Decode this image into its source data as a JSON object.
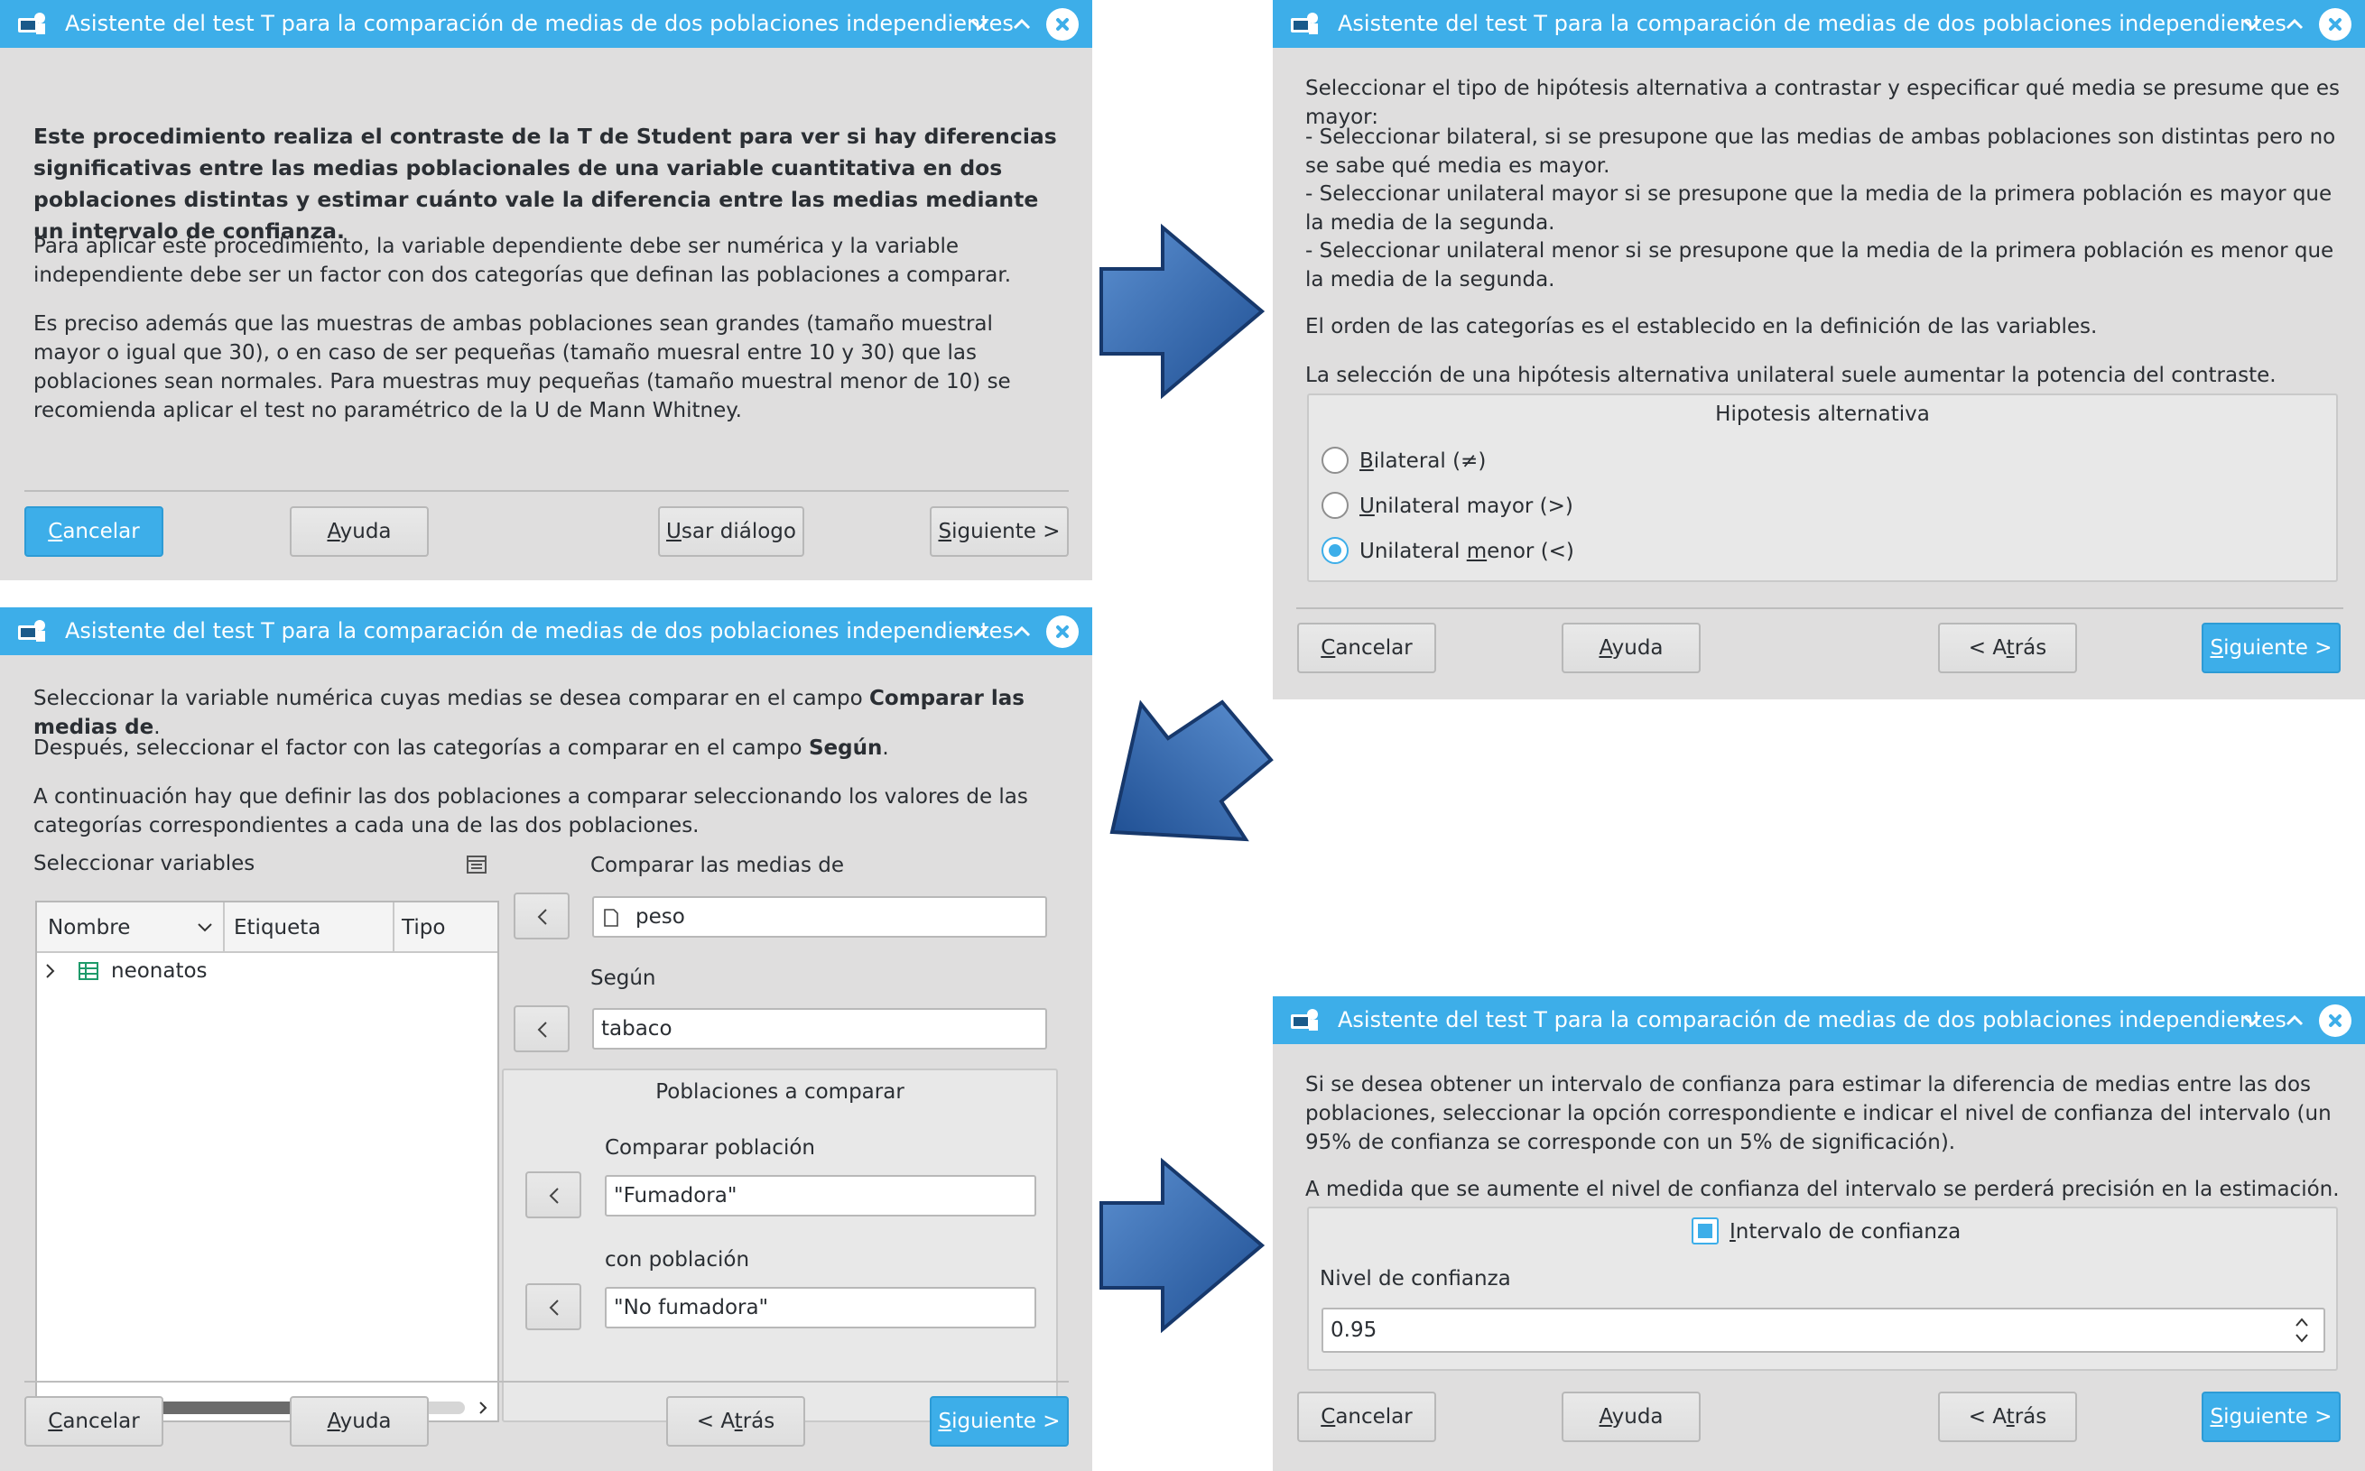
{
  "window_title": "Asistente del test T para la comparación de medias de dos poblaciones independientes",
  "buttons": {
    "cancel_pre": "",
    "cancel_ul": "C",
    "cancel_post": "ancelar",
    "help_pre": "",
    "help_ul": "A",
    "help_post": "yuda",
    "use_dialog_pre": "",
    "use_dialog_ul": "U",
    "use_dialog_post": "sar diálogo",
    "next_pre": "",
    "next_ul": "S",
    "next_post": "iguiente >",
    "back_pre": "< A",
    "back_ul": "t",
    "back_post": "rás"
  },
  "step1": {
    "intro_bold": "Este procedimiento realiza el contraste de la T de Student para ver si hay diferencias significativas entre las medias poblacionales de una variable cuantitativa en dos poblaciones distintas y estimar cuánto vale la diferencia entre las medias mediante un intervalo de confianza.",
    "para2": "Para aplicar este procedimiento, la variable dependiente debe ser numérica y la variable independiente debe ser un factor con dos categorías que definan las poblaciones a comparar.",
    "para3": "Es preciso además que las muestras de ambas poblaciones sean grandes (tamaño muestral mayor o igual que 30), o en caso de ser pequeñas (tamaño muesral entre 10 y 30) que las poblaciones sean normales. Para muestras muy pequeñas (tamaño muestral menor de 10) se recomienda aplicar el test no paramétrico de la U de Mann Whitney."
  },
  "step2": {
    "line1": "Seleccionar el tipo de hipótesis alternativa a contrastar y especificar qué media se presume que es mayor:",
    "bullet1": "- Seleccionar bilateral, si se presupone que las medias de ambas poblaciones son distintas pero no se sabe qué media es mayor.",
    "bullet2": "- Seleccionar unilateral mayor si se presupone que la media de la primera población es mayor que la media de la segunda.",
    "bullet3": "- Seleccionar unilateral menor si se presupone que la media de la primera población es menor que la media de la segunda.",
    "order": "El orden de las categorías es el establecido en la definición de las variables.",
    "power": "La selección de una hipótesis alternativa unilateral suele aumentar la potencia del contraste.",
    "group_title": "Hipotesis alternativa",
    "opt1_ul": "B",
    "opt1_post": "ilateral (≠)",
    "opt2_ul": "U",
    "opt2_post": "nilateral mayor (>)",
    "opt3_pre": "Unilateral ",
    "opt3_ul": "m",
    "opt3_post": "enor (<)",
    "selected": "Unilateral menor (<)"
  },
  "step3": {
    "line1_pre": "Seleccionar la variable numérica cuyas medias se desea comparar en el campo ",
    "line1_bold": "Comparar las medias de",
    "line1_post": ".",
    "line2_pre": "Después, seleccionar el factor con las categorías a comparar en el campo ",
    "line2_bold": "Según",
    "line2_post": ".",
    "line3": "A continuación hay que definir las dos poblaciones a comparar seleccionando los valores de las categorías correspondientes a cada una de las dos poblaciones.",
    "select_vars": "Seleccionar variables",
    "col_name": "Nombre",
    "col_label": "Etiqueta",
    "col_type": "Tipo",
    "tree_item": "neonatos",
    "compare_label": "Comparar las medias de",
    "compare_value": "peso",
    "segun_label": "Según",
    "segun_value": "tabaco",
    "pop_group": "Poblaciones a comparar",
    "pop1_label": "Comparar población",
    "pop1_value": "\"Fumadora\"",
    "pop2_label": "con población",
    "pop2_value": "\"No fumadora\""
  },
  "step4": {
    "para1": "Si se desea obtener un intervalo de confianza para estimar la diferencia de medias entre las dos poblaciones, seleccionar la opción correspondiente e indicar el nivel de confianza del intervalo (un 95% de confianza se corresponde con un 5% de significación).",
    "para2": "A medida que se aumente el nivel de confianza del intervalo se perderá precisión en la estimación.",
    "ci_ul": "I",
    "ci_post": "ntervalo de confianza",
    "level_label": "Nivel de confianza",
    "level_value": "0.95"
  },
  "colors": {
    "accent": "#3daee9",
    "window_bg": "#dfdede",
    "arrow": "#2f63a8"
  }
}
